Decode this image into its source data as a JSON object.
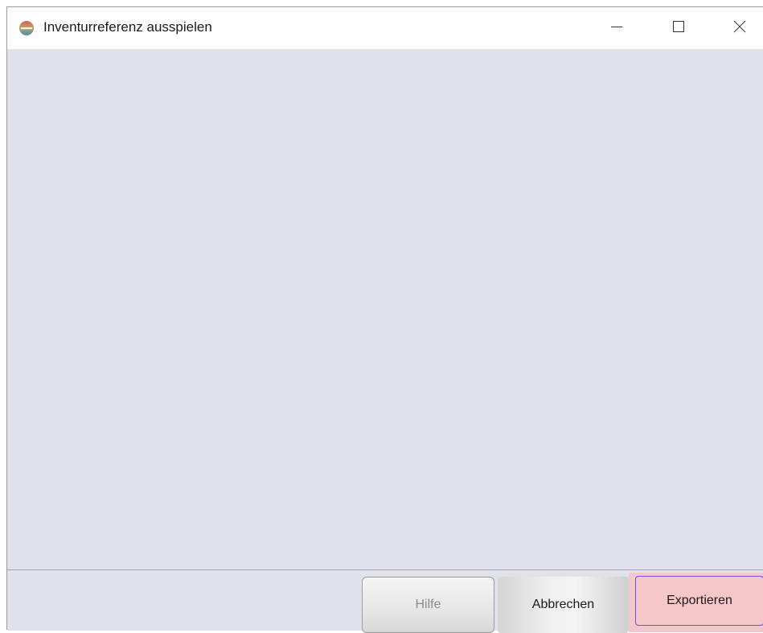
{
  "window": {
    "title": "Inventurreferenz ausspielen",
    "icon": "app-globe-icon"
  },
  "controls": {
    "minimize_icon": "minimize-icon",
    "maximize_icon": "maximize-icon",
    "close_icon": "close-icon"
  },
  "footer": {
    "help_label": "Hilfe",
    "cancel_label": "Abbrechen",
    "export_label": "Exportieren"
  },
  "colors": {
    "content_background": "#e1e1eb",
    "export_highlight": "#f5c7c9",
    "export_border": "#6b55d6",
    "disabled_text": "#8a8a8a"
  }
}
